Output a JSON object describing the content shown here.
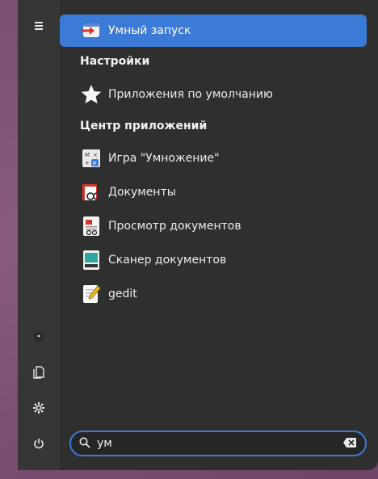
{
  "results": {
    "top": {
      "label": "Умный запуск",
      "icon": "smart-launch-icon"
    },
    "sections": [
      {
        "title": "Настройки",
        "items": [
          {
            "label": "Приложения по умолчанию",
            "icon": "star-icon"
          }
        ]
      },
      {
        "title": "Центр приложений",
        "items": [
          {
            "label": "Игра \"Умножение\"",
            "icon": "multiplication-game-icon"
          },
          {
            "label": "Документы",
            "icon": "documents-icon"
          },
          {
            "label": "Просмотр документов",
            "icon": "document-viewer-icon"
          },
          {
            "label": "Сканер документов",
            "icon": "scanner-icon"
          },
          {
            "label": "gedit",
            "icon": "gedit-icon"
          }
        ]
      }
    ]
  },
  "search": {
    "value": "ум"
  },
  "rail": [
    "menu-icon",
    "home-dot-icon",
    "documents-rail-icon",
    "settings-icon",
    "power-icon"
  ],
  "colors": {
    "accent": "#3b7ad6",
    "panel": "#2f2f2f",
    "rail": "#363636"
  }
}
